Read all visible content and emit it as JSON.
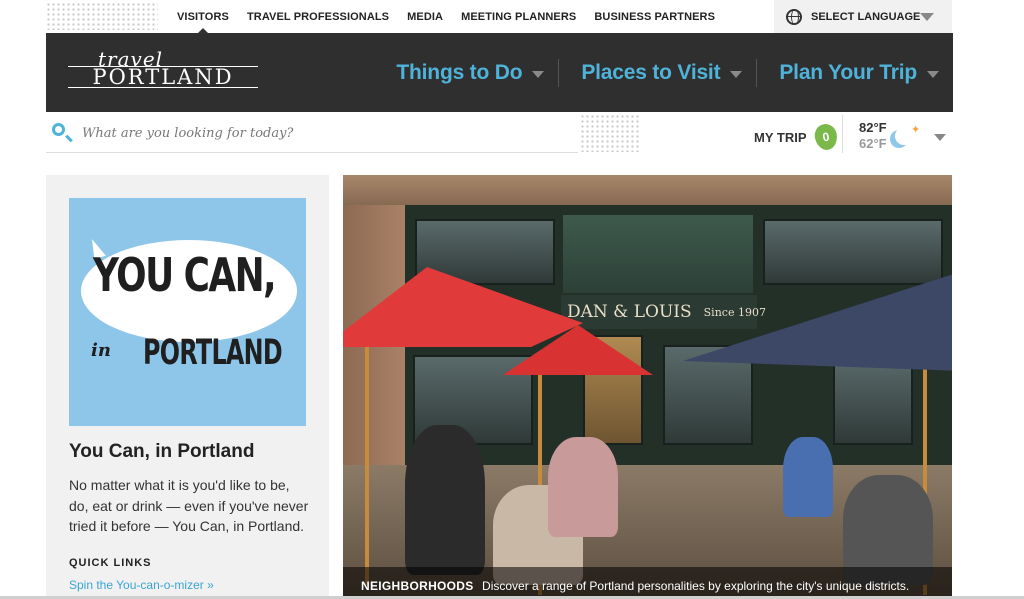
{
  "top_nav": {
    "items": [
      "VISITORS",
      "TRAVEL PROFESSIONALS",
      "MEDIA",
      "MEETING PLANNERS",
      "BUSINESS PARTNERS"
    ],
    "active": "VISITORS",
    "language_label": "SELECT LANGUAGE"
  },
  "logo": {
    "line1": "travel",
    "line2": "PORTLAND"
  },
  "main_nav": {
    "items": [
      "Things to Do",
      "Places to Visit",
      "Plan Your Trip"
    ],
    "color": "#4fb3d9"
  },
  "search": {
    "placeholder": "What are you looking for today?"
  },
  "my_trip": {
    "label": "MY TRIP",
    "count": "0",
    "badge_color": "#7bb84a"
  },
  "weather": {
    "high": "82°F",
    "low": "62°F"
  },
  "promo": {
    "line1": "YOU CAN,",
    "line2_small": "in",
    "line2": "PORTLAND",
    "title": "You Can, in Portland",
    "body": "No matter what it is you'd like to be, do, eat or drink — even if you've never tried it before — You Can, in Portland.",
    "quick_links_heading": "QUICK LINKS",
    "quick_link": "Spin the You-can-o-mizer »"
  },
  "hero": {
    "sign_name": "DAN & LOUIS",
    "sign_since": "Since 1907",
    "caption_label": "NEIGHBORHOODS",
    "caption_text": "Discover a range of Portland personalities by exploring the city's unique districts."
  }
}
